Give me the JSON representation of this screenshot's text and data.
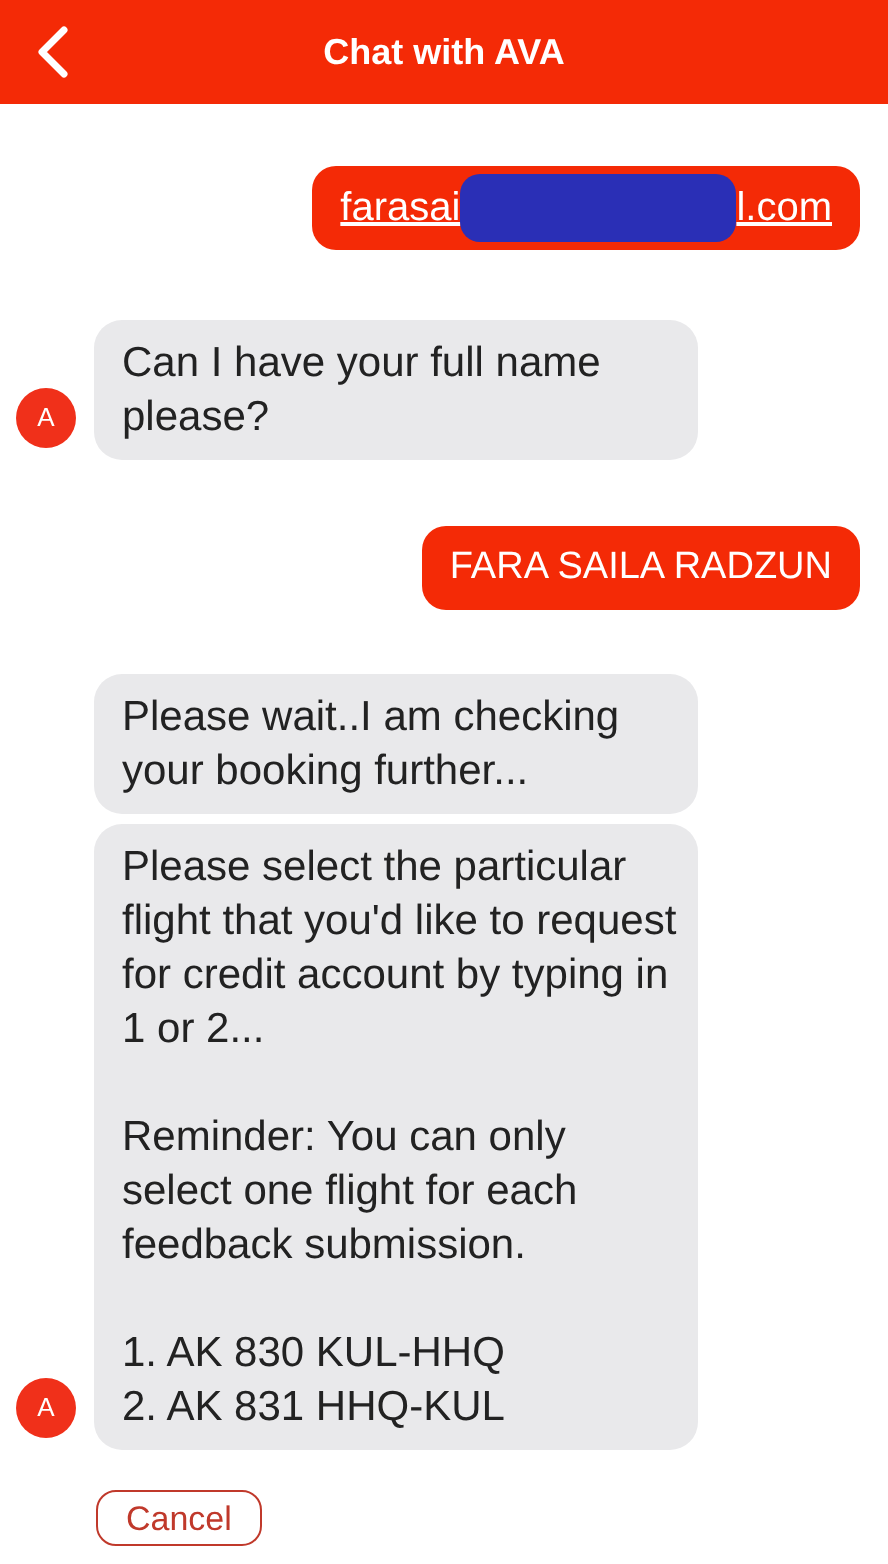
{
  "header": {
    "title": "Chat with AVA"
  },
  "messages": [
    {
      "kind": "user_email",
      "start": "farasai",
      "end": "l.com"
    },
    {
      "kind": "bot_text",
      "avatar": "A",
      "text": "Can I have your full name please?"
    },
    {
      "kind": "user_text",
      "text": "FARA SAILA RADZUN"
    },
    {
      "kind": "bot_text",
      "text": "Please wait..I am checking your booking further..."
    },
    {
      "kind": "bot_text",
      "avatar": "A",
      "text": "Please select the particular flight that you'd like to request for credit account by typing in 1 or 2...\n\nReminder: You can only select one flight for each feedback submission.\n\n1. AK 830 KUL-HHQ\n2. AK 831 HHQ-KUL"
    }
  ],
  "actions": [
    {
      "label": "Cancel"
    }
  ]
}
